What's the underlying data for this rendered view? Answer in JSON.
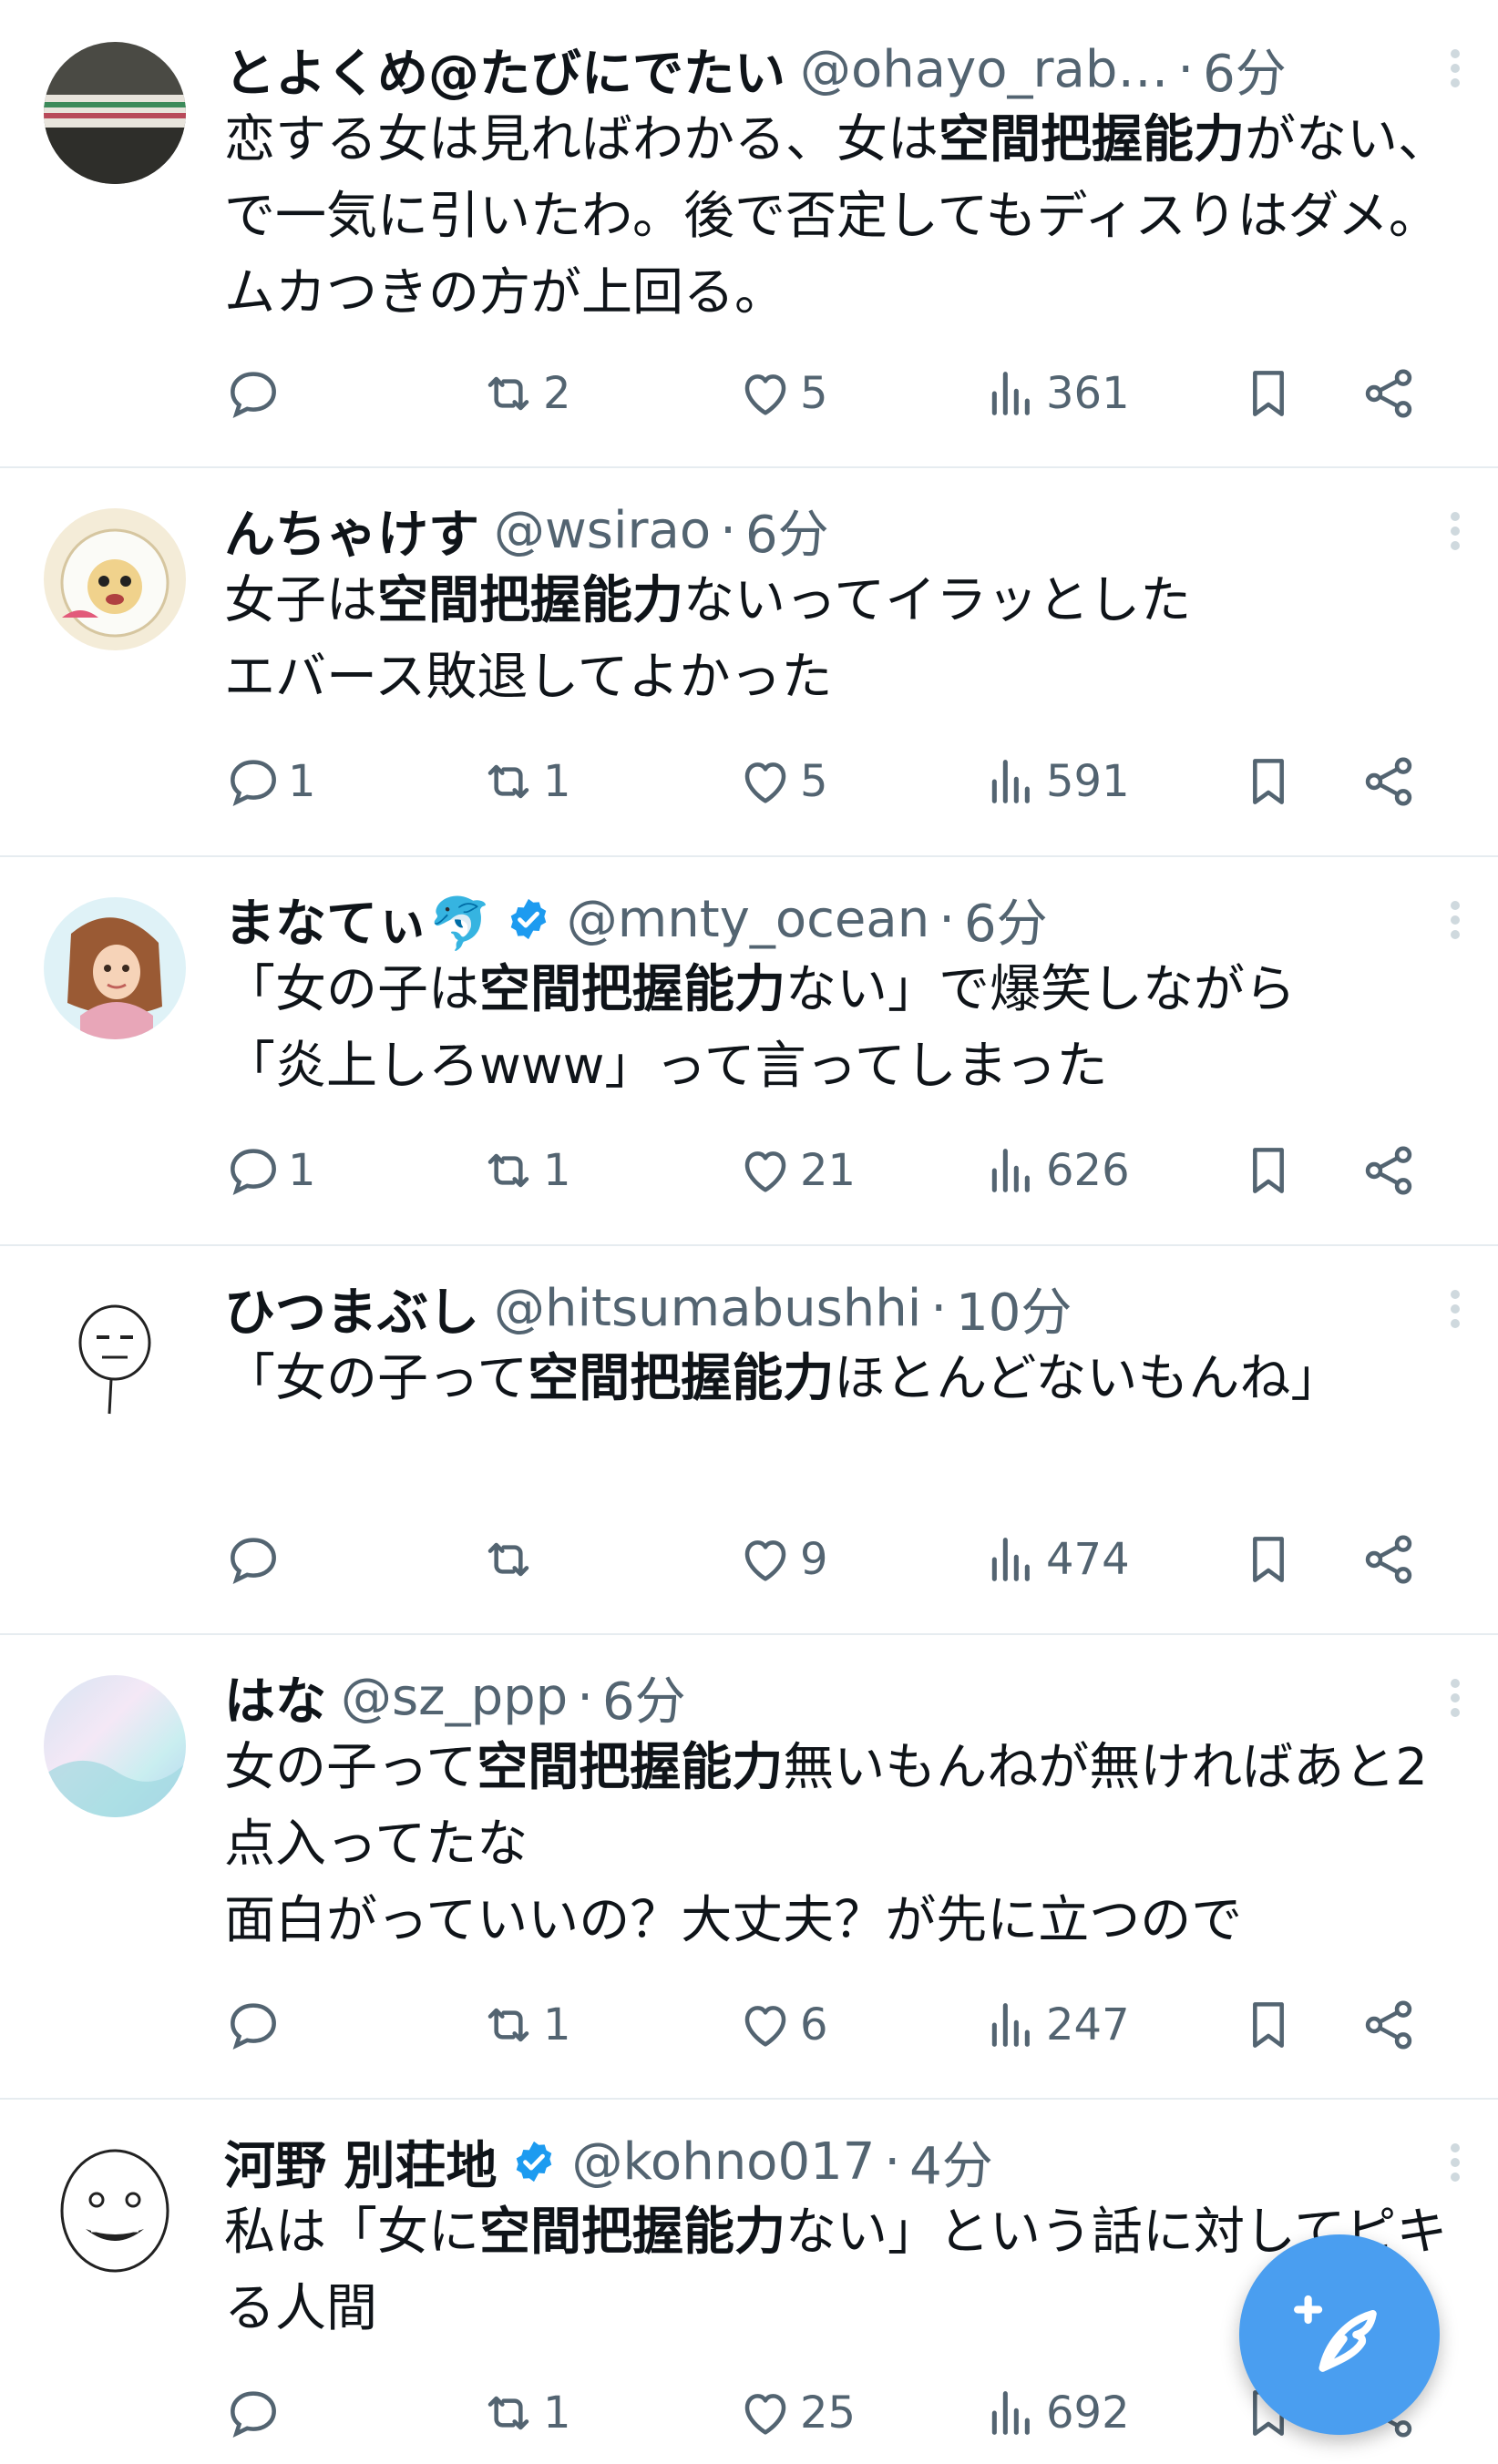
{
  "tweets": [
    {
      "name": "とよくめ@たびにでたい",
      "handle": "@ohayo_rab…",
      "time": "6分",
      "verified": false,
      "text_parts": [
        "恋する女は見ればわかる、女は",
        "空間把握能力",
        "がない、で一気に引いたわ。後で否定してもディスりはダメ。ムカつきの方が上回る。"
      ],
      "replies": "",
      "retweets": "2",
      "likes": "5",
      "views": "361"
    },
    {
      "name": "んちゃけす",
      "handle": "@wsirao",
      "time": "6分",
      "verified": false,
      "text_parts": [
        "女子は",
        "空間把握能力",
        "ないってイラッとした\nエバース敗退してよかった"
      ],
      "replies": "1",
      "retweets": "1",
      "likes": "5",
      "views": "591"
    },
    {
      "name": "まなてぃ🐬",
      "handle": "@mnty_ocean",
      "time": "6分",
      "verified": true,
      "text_parts": [
        "「女の子は",
        "空間把握能力",
        "ない」で爆笑しながら\n「炎上しろwww」って言ってしまった"
      ],
      "replies": "1",
      "retweets": "1",
      "likes": "21",
      "views": "626"
    },
    {
      "name": "ひつまぶし",
      "handle": "@hitsumabushhi",
      "time": "10分",
      "verified": false,
      "text_parts": [
        "「女の子って",
        "空間把握能力",
        "ほとんどないもんね」"
      ],
      "replies": "",
      "retweets": "",
      "likes": "9",
      "views": "474"
    },
    {
      "name": "はな",
      "handle": "@sz_ppp",
      "time": "6分",
      "verified": false,
      "text_parts": [
        "女の子って",
        "空間把握能力",
        "無いもんねが無ければあと2点入ってたな\n面白がっていいの？大丈夫？が先に立つので"
      ],
      "replies": "",
      "retweets": "1",
      "likes": "6",
      "views": "247"
    },
    {
      "name": "河野 別荘地",
      "handle": "@kohno017",
      "time": "4分",
      "verified": true,
      "text_parts": [
        "私は「女に",
        "空間把握能力",
        "ない」という話に対してピキる人間"
      ],
      "replies": "",
      "retweets": "1",
      "likes": "25",
      "views": "692"
    }
  ],
  "colors": {
    "accent": "#1d9bf0",
    "muted": "#536471",
    "divider": "#e6ecf0",
    "fab": "#4a9ef0"
  },
  "icons": [
    "reply-icon",
    "retweet-icon",
    "like-icon",
    "views-icon",
    "bookmark-icon",
    "share-icon",
    "more-icon",
    "verified-icon",
    "compose-icon"
  ]
}
